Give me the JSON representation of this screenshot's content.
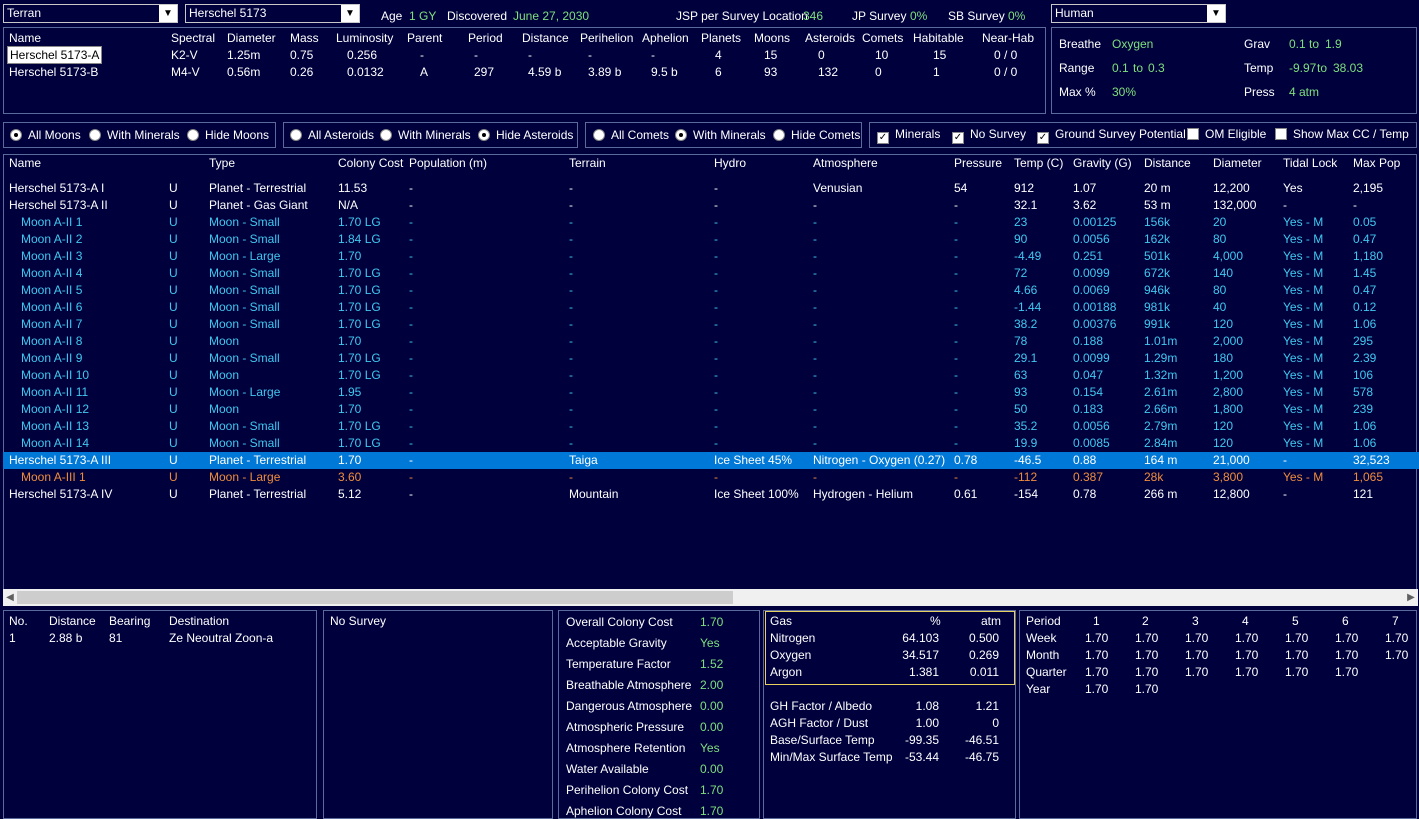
{
  "top": {
    "race_select": "Terran",
    "system_select": "Herschel 5173",
    "age_label": "Age",
    "age_value": "1 GY",
    "discovered_label": "Discovered",
    "discovered_value": "June 27, 2030",
    "jsp_label": "JSP per Survey Location",
    "jsp_value": "346",
    "jp_label": "JP Survey",
    "jp_value": "0%",
    "sb_label": "SB Survey",
    "sb_value": "0%",
    "species_select": "Human"
  },
  "stars": {
    "headers": [
      "Name",
      "Spectral",
      "Diameter",
      "Mass",
      "Luminosity",
      "Parent",
      "Period",
      "Distance",
      "Perihelion",
      "Aphelion",
      "Planets",
      "Moons",
      "Asteroids",
      "Comets",
      "Habitable",
      "Near-Hab"
    ],
    "rows": [
      [
        "Herschel 5173-A",
        "K2-V",
        "1.25m",
        "0.75",
        "0.256",
        "-",
        "-",
        "-",
        "-",
        "-",
        "4",
        "15",
        "0",
        "10",
        "15",
        "0 / 0"
      ],
      [
        "Herschel 5173-B",
        "M4-V",
        "0.56m",
        "0.26",
        "0.0132",
        "A",
        "297",
        "4.59 b",
        "3.89 b",
        "9.5 b",
        "6",
        "93",
        "132",
        "0",
        "1",
        "0 / 0"
      ]
    ]
  },
  "species": {
    "breathe_label": "Breathe",
    "breathe_value": "Oxygen",
    "range_label": "Range",
    "range_min": "0.1",
    "range_to": "to",
    "range_max": "0.3",
    "maxpct_label": "Max %",
    "maxpct_value": "30%",
    "grav_label": "Grav",
    "grav_min": "0.1",
    "grav_to": "to",
    "grav_max": "1.9",
    "temp_label": "Temp",
    "temp_min": "-9.97",
    "temp_to": "to",
    "temp_max": "38.03",
    "press_label": "Press",
    "press_value": "4 atm"
  },
  "filters": {
    "moons": [
      "All Moons",
      "With Minerals",
      "Hide Moons"
    ],
    "asteroids": [
      "All Asteroids",
      "With Minerals",
      "Hide Asteroids"
    ],
    "comets": [
      "All Comets",
      "With Minerals",
      "Hide Comets"
    ],
    "checks": [
      "Minerals",
      "No Survey",
      "Ground Survey Potential",
      "OM Eligible",
      "Show Max CC / Temp"
    ]
  },
  "bodies": {
    "headers": [
      "Name",
      "Type",
      "Colony Cost",
      "Population (m)",
      "Terrain",
      "Hydro",
      "Atmosphere",
      "Pressure",
      "Temp (C)",
      "Gravity (G)",
      "Distance",
      "Diameter",
      "Tidal Lock",
      "Max Pop"
    ],
    "rows": [
      {
        "style": "white",
        "name": "Herschel 5173-A I",
        "u": "U",
        "type": "Planet - Terrestrial",
        "cc": "11.53",
        "pop": "-",
        "terrain": "-",
        "hydro": "-",
        "atmo": "Venusian",
        "press": "54",
        "temp": "912",
        "grav": "1.07",
        "dist": "20 m",
        "diam": "12,200",
        "tidal": "Yes",
        "maxpop": "2,195"
      },
      {
        "style": "white",
        "name": "Herschel 5173-A II",
        "u": "U",
        "type": "Planet - Gas Giant",
        "cc": "N/A",
        "pop": "-",
        "terrain": "-",
        "hydro": "-",
        "atmo": "-",
        "press": "-",
        "temp": "32.1",
        "grav": "3.62",
        "dist": "53 m",
        "diam": "132,000",
        "tidal": "-",
        "maxpop": "-"
      },
      {
        "style": "cyan",
        "name": "Moon A-II 1",
        "u": "U",
        "type": "Moon - Small",
        "cc": "1.70 LG",
        "pop": "-",
        "terrain": "-",
        "hydro": "-",
        "atmo": "-",
        "press": "-",
        "temp": "23",
        "grav": "0.00125",
        "dist": "156k",
        "diam": "20",
        "tidal": "Yes - M",
        "maxpop": "0.05"
      },
      {
        "style": "cyan",
        "name": "Moon A-II 2",
        "u": "U",
        "type": "Moon - Small",
        "cc": "1.84 LG",
        "pop": "-",
        "terrain": "-",
        "hydro": "-",
        "atmo": "-",
        "press": "-",
        "temp": "90",
        "grav": "0.0056",
        "dist": "162k",
        "diam": "80",
        "tidal": "Yes - M",
        "maxpop": "0.47"
      },
      {
        "style": "cyan",
        "name": "Moon A-II 3",
        "u": "U",
        "type": "Moon - Large",
        "cc": "1.70",
        "pop": "-",
        "terrain": "-",
        "hydro": "-",
        "atmo": "-",
        "press": "-",
        "temp": "-4.49",
        "grav": "0.251",
        "dist": "501k",
        "diam": "4,000",
        "tidal": "Yes - M",
        "maxpop": "1,180"
      },
      {
        "style": "cyan",
        "name": "Moon A-II 4",
        "u": "U",
        "type": "Moon - Small",
        "cc": "1.70 LG",
        "pop": "-",
        "terrain": "-",
        "hydro": "-",
        "atmo": "-",
        "press": "-",
        "temp": "72",
        "grav": "0.0099",
        "dist": "672k",
        "diam": "140",
        "tidal": "Yes - M",
        "maxpop": "1.45"
      },
      {
        "style": "cyan",
        "name": "Moon A-II 5",
        "u": "U",
        "type": "Moon - Small",
        "cc": "1.70 LG",
        "pop": "-",
        "terrain": "-",
        "hydro": "-",
        "atmo": "-",
        "press": "-",
        "temp": "4.66",
        "grav": "0.0069",
        "dist": "946k",
        "diam": "80",
        "tidal": "Yes - M",
        "maxpop": "0.47"
      },
      {
        "style": "cyan",
        "name": "Moon A-II 6",
        "u": "U",
        "type": "Moon - Small",
        "cc": "1.70 LG",
        "pop": "-",
        "terrain": "-",
        "hydro": "-",
        "atmo": "-",
        "press": "-",
        "temp": "-1.44",
        "grav": "0.00188",
        "dist": "981k",
        "diam": "40",
        "tidal": "Yes - M",
        "maxpop": "0.12"
      },
      {
        "style": "cyan",
        "name": "Moon A-II 7",
        "u": "U",
        "type": "Moon - Small",
        "cc": "1.70 LG",
        "pop": "-",
        "terrain": "-",
        "hydro": "-",
        "atmo": "-",
        "press": "-",
        "temp": "38.2",
        "grav": "0.00376",
        "dist": "991k",
        "diam": "120",
        "tidal": "Yes - M",
        "maxpop": "1.06"
      },
      {
        "style": "cyan",
        "name": "Moon A-II 8",
        "u": "U",
        "type": "Moon",
        "cc": "1.70",
        "pop": "-",
        "terrain": "-",
        "hydro": "-",
        "atmo": "-",
        "press": "-",
        "temp": "78",
        "grav": "0.188",
        "dist": "1.01m",
        "diam": "2,000",
        "tidal": "Yes - M",
        "maxpop": "295"
      },
      {
        "style": "cyan",
        "name": "Moon A-II 9",
        "u": "U",
        "type": "Moon - Small",
        "cc": "1.70 LG",
        "pop": "-",
        "terrain": "-",
        "hydro": "-",
        "atmo": "-",
        "press": "-",
        "temp": "29.1",
        "grav": "0.0099",
        "dist": "1.29m",
        "diam": "180",
        "tidal": "Yes - M",
        "maxpop": "2.39"
      },
      {
        "style": "cyan",
        "name": "Moon A-II 10",
        "u": "U",
        "type": "Moon",
        "cc": "1.70 LG",
        "pop": "-",
        "terrain": "-",
        "hydro": "-",
        "atmo": "-",
        "press": "-",
        "temp": "63",
        "grav": "0.047",
        "dist": "1.32m",
        "diam": "1,200",
        "tidal": "Yes - M",
        "maxpop": "106"
      },
      {
        "style": "cyan",
        "name": "Moon A-II 11",
        "u": "U",
        "type": "Moon - Large",
        "cc": "1.95",
        "pop": "-",
        "terrain": "-",
        "hydro": "-",
        "atmo": "-",
        "press": "-",
        "temp": "93",
        "grav": "0.154",
        "dist": "2.61m",
        "diam": "2,800",
        "tidal": "Yes - M",
        "maxpop": "578"
      },
      {
        "style": "cyan",
        "name": "Moon A-II 12",
        "u": "U",
        "type": "Moon",
        "cc": "1.70",
        "pop": "-",
        "terrain": "-",
        "hydro": "-",
        "atmo": "-",
        "press": "-",
        "temp": "50",
        "grav": "0.183",
        "dist": "2.66m",
        "diam": "1,800",
        "tidal": "Yes - M",
        "maxpop": "239"
      },
      {
        "style": "cyan",
        "name": "Moon A-II 13",
        "u": "U",
        "type": "Moon - Small",
        "cc": "1.70 LG",
        "pop": "-",
        "terrain": "-",
        "hydro": "-",
        "atmo": "-",
        "press": "-",
        "temp": "35.2",
        "grav": "0.0056",
        "dist": "2.79m",
        "diam": "120",
        "tidal": "Yes - M",
        "maxpop": "1.06"
      },
      {
        "style": "cyan",
        "name": "Moon A-II 14",
        "u": "U",
        "type": "Moon - Small",
        "cc": "1.70 LG",
        "pop": "-",
        "terrain": "-",
        "hydro": "-",
        "atmo": "-",
        "press": "-",
        "temp": "19.9",
        "grav": "0.0085",
        "dist": "2.84m",
        "diam": "120",
        "tidal": "Yes - M",
        "maxpop": "1.06"
      },
      {
        "style": "sel",
        "name": "Herschel 5173-A III",
        "u": "U",
        "type": "Planet - Terrestrial",
        "cc": "1.70",
        "pop": "-",
        "terrain": "Taiga",
        "hydro": "Ice Sheet 45%",
        "atmo": "Nitrogen - Oxygen (0.27)",
        "press": "0.78",
        "temp": "-46.5",
        "grav": "0.88",
        "dist": "164 m",
        "diam": "21,000",
        "tidal": "-",
        "maxpop": "32,523"
      },
      {
        "style": "orange",
        "name": "Moon A-III 1",
        "u": "U",
        "type": "Moon - Large",
        "cc": "3.60",
        "pop": "-",
        "terrain": "-",
        "hydro": "-",
        "atmo": "-",
        "press": "-",
        "temp": "-112",
        "grav": "0.387",
        "dist": "28k",
        "diam": "3,800",
        "tidal": "Yes - M",
        "maxpop": "1,065"
      },
      {
        "style": "white",
        "name": "Herschel 5173-A IV",
        "u": "U",
        "type": "Planet - Terrestrial",
        "cc": "5.12",
        "pop": "-",
        "terrain": "Mountain",
        "hydro": "Ice Sheet 100%",
        "atmo": "Hydrogen - Helium",
        "press": "0.61",
        "temp": "-154",
        "grav": "0.78",
        "dist": "266 m",
        "diam": "12,800",
        "tidal": "-",
        "maxpop": "121"
      }
    ]
  },
  "jump": {
    "headers": [
      "No.",
      "Distance",
      "Bearing",
      "Destination"
    ],
    "rows": [
      [
        "1",
        "2.88 b",
        "81",
        "Ze Neoutral Zoon-a"
      ]
    ]
  },
  "survey": {
    "text": "No Survey"
  },
  "colony": {
    "rows": [
      [
        "Overall Colony Cost",
        "1.70"
      ],
      [
        "Acceptable Gravity",
        "Yes"
      ],
      [
        "Temperature Factor",
        "1.52"
      ],
      [
        "Breathable Atmosphere",
        "2.00"
      ],
      [
        "Dangerous Atmosphere",
        "0.00"
      ],
      [
        "Atmospheric Pressure",
        "0.00"
      ],
      [
        "Atmosphere Retention",
        "Yes"
      ],
      [
        "Water Available",
        "0.00"
      ],
      [
        "Perihelion Colony Cost",
        "1.70"
      ],
      [
        "Aphelion Colony Cost",
        "1.70"
      ]
    ]
  },
  "gas": {
    "headers": [
      "Gas",
      "%",
      "atm"
    ],
    "rows": [
      [
        "Nitrogen",
        "64.103",
        "0.500"
      ],
      [
        "Oxygen",
        "34.517",
        "0.269"
      ],
      [
        "Argon",
        "1.381",
        "0.011"
      ]
    ],
    "factors": [
      [
        "GH Factor / Albedo",
        "1.08",
        "1.21"
      ],
      [
        "AGH Factor / Dust",
        "1.00",
        "0"
      ],
      [
        "Base/Surface Temp",
        "-99.35",
        "-46.51"
      ],
      [
        "Min/Max Surface Temp",
        "-53.44",
        "-46.75"
      ]
    ]
  },
  "period": {
    "headers": [
      "Period",
      "1",
      "2",
      "3",
      "4",
      "5",
      "6",
      "7"
    ],
    "rows": [
      [
        "Week",
        "1.70",
        "1.70",
        "1.70",
        "1.70",
        "1.70",
        "1.70",
        "1.70"
      ],
      [
        "Month",
        "1.70",
        "1.70",
        "1.70",
        "1.70",
        "1.70",
        "1.70",
        "1.70"
      ],
      [
        "Quarter",
        "1.70",
        "1.70",
        "1.70",
        "1.70",
        "1.70",
        "1.70",
        ""
      ],
      [
        "Year",
        "1.70",
        "1.70",
        "",
        "",
        "",
        "",
        ""
      ]
    ]
  }
}
